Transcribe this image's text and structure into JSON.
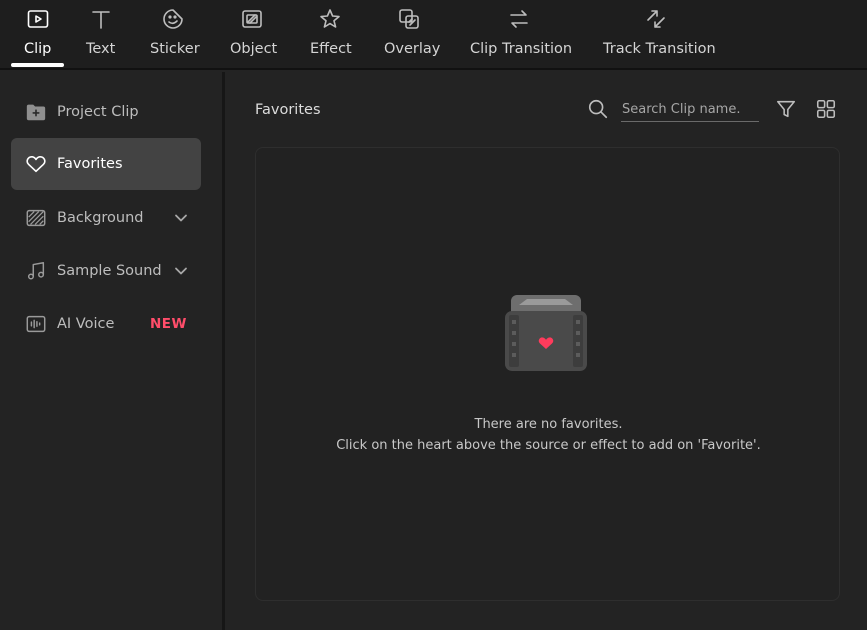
{
  "toolbar": {
    "tabs": [
      {
        "label": "Clip",
        "icon": "clip-icon"
      },
      {
        "label": "Text",
        "icon": "text-icon"
      },
      {
        "label": "Sticker",
        "icon": "sticker-icon"
      },
      {
        "label": "Object",
        "icon": "object-icon"
      },
      {
        "label": "Effect",
        "icon": "effect-icon"
      },
      {
        "label": "Overlay",
        "icon": "overlay-icon"
      },
      {
        "label": "Clip Transition",
        "icon": "clip-transition-icon"
      },
      {
        "label": "Track Transition",
        "icon": "track-transition-icon"
      }
    ],
    "active_tab": "Clip"
  },
  "sidebar": {
    "items": [
      {
        "label": "Project Clip",
        "icon": "folder-plus-icon"
      },
      {
        "label": "Favorites",
        "icon": "heart-icon",
        "active": true
      },
      {
        "label": "Background",
        "icon": "background-pattern-icon",
        "expandable": true
      },
      {
        "label": "Sample Sound",
        "icon": "music-note-icon",
        "expandable": true
      },
      {
        "label": "AI Voice",
        "icon": "waveform-icon",
        "badge": "NEW"
      }
    ]
  },
  "main": {
    "title": "Favorites",
    "search": {
      "placeholder": "Search Clip name.",
      "value": ""
    },
    "empty_state": {
      "line1": "There are no favorites.",
      "line2": "Click on the heart above the source or effect to add on 'Favorite'."
    }
  },
  "colors": {
    "background": "#232323",
    "toolbar_bg": "#1e1e1e",
    "active_item_bg": "#434343",
    "badge_new": "#ff4d6a",
    "heart": "#ff3b5c"
  }
}
